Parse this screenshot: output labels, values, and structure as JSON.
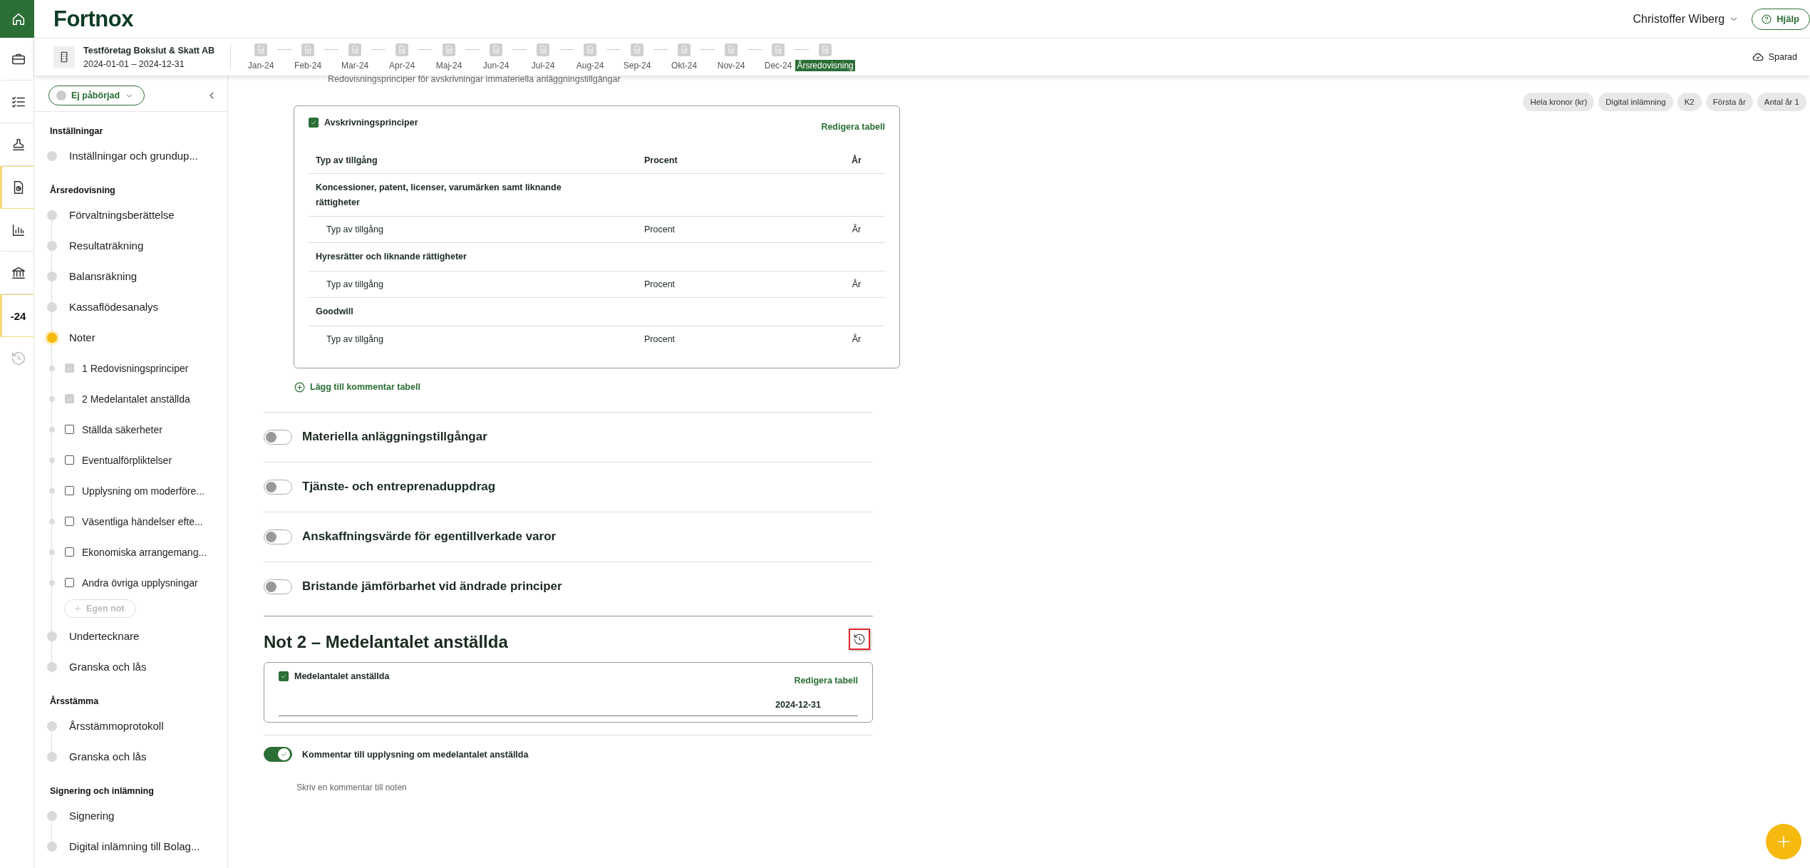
{
  "rail": [
    {
      "kind": "home",
      "marked": false,
      "disabled": false
    },
    {
      "kind": "briefcase",
      "marked": false,
      "disabled": false
    },
    {
      "kind": "checklist",
      "marked": false,
      "disabled": false
    },
    {
      "kind": "stamp",
      "marked": false,
      "disabled": false
    },
    {
      "kind": "document",
      "marked": true,
      "disabled": false
    },
    {
      "kind": "chart",
      "marked": false,
      "disabled": false
    },
    {
      "kind": "bank",
      "marked": false,
      "disabled": false
    },
    {
      "kind": "text",
      "label": "-24",
      "marked": true,
      "disabled": false
    },
    {
      "kind": "history",
      "marked": false,
      "disabled": true
    }
  ],
  "header": {
    "logo": "Fortnox",
    "user": "Christoffer Wiberg",
    "help": "Hjälp"
  },
  "subheader": {
    "company": "Testföretag Bokslut & Skatt AB",
    "period": "2024-01-01 – 2024-12-31",
    "periods": [
      {
        "label": "Jan-24",
        "selected": false
      },
      {
        "label": "Feb-24",
        "selected": false
      },
      {
        "label": "Mar-24",
        "selected": false
      },
      {
        "label": "Apr-24",
        "selected": false
      },
      {
        "label": "Maj-24",
        "selected": false
      },
      {
        "label": "Jun-24",
        "selected": false
      },
      {
        "label": "Jul-24",
        "selected": false
      },
      {
        "label": "Aug-24",
        "selected": false
      },
      {
        "label": "Sep-24",
        "selected": false
      },
      {
        "label": "Okt-24",
        "selected": false
      },
      {
        "label": "Nov-24",
        "selected": false
      },
      {
        "label": "Dec-24",
        "selected": false
      },
      {
        "label": "Årsredovisning",
        "selected": true
      }
    ],
    "save_status": "Sparad"
  },
  "sidebar": {
    "status": "Ej påbörjad",
    "sections": [
      {
        "title": "Inställningar",
        "items": [
          {
            "label": "Inställningar och grundup...",
            "current": false
          }
        ]
      },
      {
        "title": "Årsredovisning",
        "items": [
          {
            "label": "Förvaltningsberättelse",
            "current": false
          },
          {
            "label": "Resultaträkning",
            "current": false
          },
          {
            "label": "Balansräkning",
            "current": false
          },
          {
            "label": "Kassaflödesanalys",
            "current": false
          },
          {
            "label": "Noter",
            "current": true,
            "children": [
              {
                "label": "1 Redovisningsprinciper",
                "checked": true
              },
              {
                "label": "2 Medelantalet anställda",
                "checked": true
              },
              {
                "label": "Ställda säkerheter",
                "checked": false
              },
              {
                "label": "Eventualförpliktelser",
                "checked": false
              },
              {
                "label": "Upplysning om moderföre...",
                "checked": false
              },
              {
                "label": "Väsentliga händelser efte...",
                "checked": false
              },
              {
                "label": "Ekonomiska arrangemang...",
                "checked": false
              },
              {
                "label": "Andra övriga upplysningar",
                "checked": false
              }
            ],
            "add_button": "Egen not"
          },
          {
            "label": "Undertecknare",
            "current": false
          },
          {
            "label": "Granska och lås",
            "current": false
          }
        ]
      },
      {
        "title": "Årsstämma",
        "items": [
          {
            "label": "Årsstämmoprotokoll",
            "current": false
          },
          {
            "label": "Granska och lås",
            "current": false
          }
        ]
      },
      {
        "title": "Signering och inlämning",
        "items": [
          {
            "label": "Signering",
            "current": false
          },
          {
            "label": "Digital inlämning till Bolag...",
            "current": false
          }
        ]
      }
    ]
  },
  "main": {
    "caption": "Redovisningsprinciper för avskrivningar immateriella anläggningstillgångar",
    "chips": [
      "Hela kronor (kr)",
      "Digital inlämning",
      "K2",
      "Första år",
      "Antal år 1"
    ],
    "table_card": {
      "title": "Avskrivningsprinciper",
      "checked": true,
      "edit": "Redigera tabell",
      "columns": [
        "Typ av tillgång",
        "Procent",
        "År"
      ],
      "groups": [
        {
          "title": "Koncessioner, patent, licenser, varumärken samt liknande rättigheter",
          "rows": [
            [
              "Typ av tillgång",
              "Procent",
              "År"
            ]
          ]
        },
        {
          "title": "Hyresrätter och liknande rättigheter",
          "rows": [
            [
              "Typ av tillgång",
              "Procent",
              "År"
            ]
          ]
        },
        {
          "title": "Goodwill",
          "rows": [
            [
              "Typ av tillgång",
              "Procent",
              "År"
            ]
          ]
        }
      ]
    },
    "add_comment": "Lägg till kommentar tabell",
    "toggles": [
      {
        "label": "Materiella anläggningstillgångar",
        "on": false
      },
      {
        "label": "Tjänste- och entreprenaduppdrag",
        "on": false
      },
      {
        "label": "Anskaffningsvärde för egentillverkade varor",
        "on": false
      },
      {
        "label": "Bristande jämförbarhet vid ändrade principer",
        "on": false
      }
    ],
    "note": {
      "title": "Not 2 – Medelantalet anställda",
      "history_highlighted": true,
      "card": {
        "title": "Medelantalet anställda",
        "checked": true,
        "edit": "Redigera tabell",
        "columns": [
          "2024-12-31"
        ]
      },
      "comment_toggle": {
        "label": "Kommentar till upplysning om medelantalet anställda",
        "on": true
      },
      "comment_placeholder": "Skriv en kommentar till noten"
    }
  }
}
